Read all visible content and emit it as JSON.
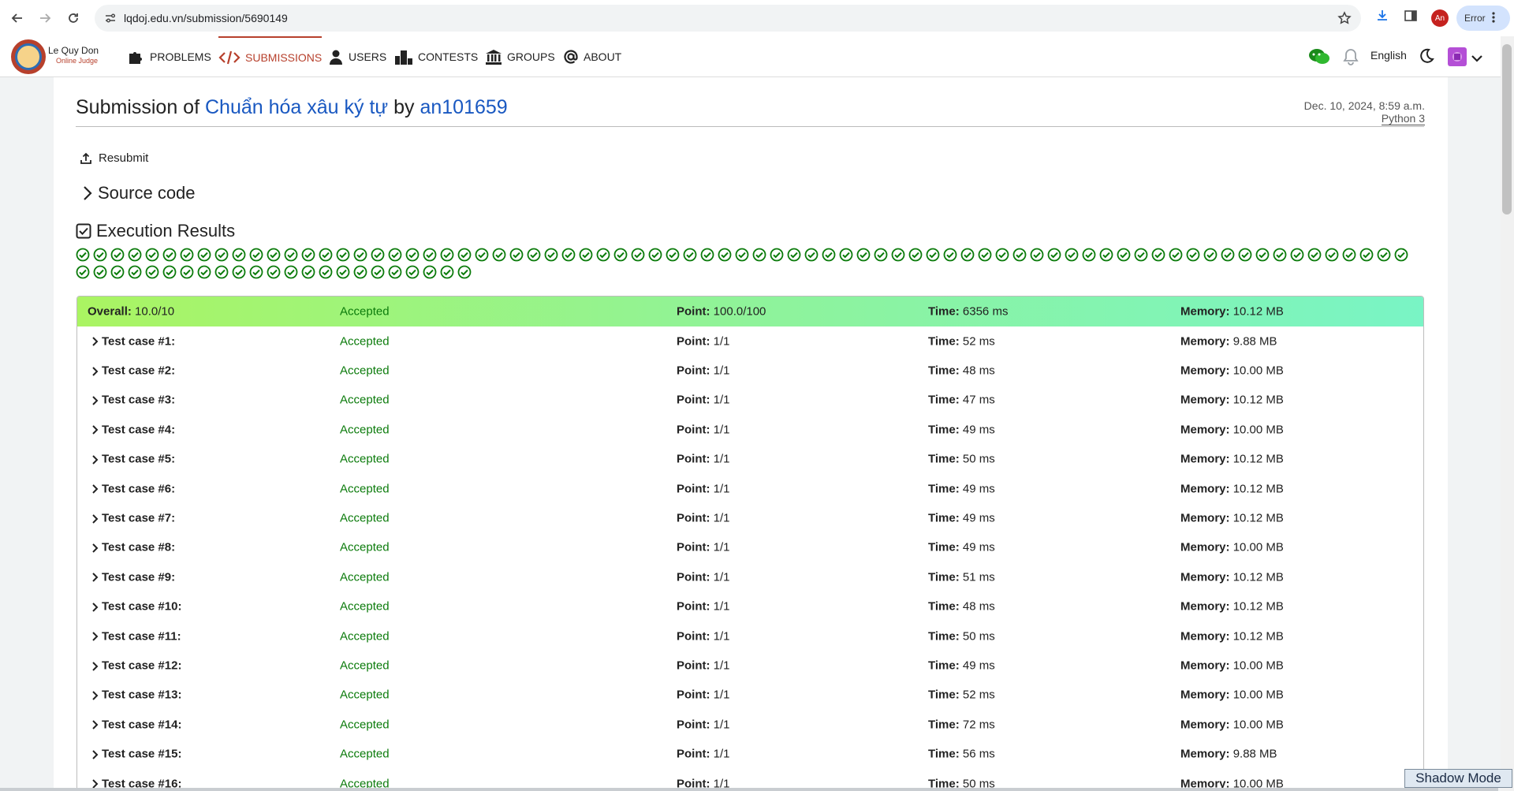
{
  "browser": {
    "url": "lqdoj.edu.vn/submission/5690149",
    "profile_initials": "An",
    "error_label": "Error"
  },
  "site": {
    "logo_line1": "Le Quy Don",
    "logo_line2": "Online Judge",
    "menu": [
      {
        "label": "PROBLEMS",
        "icon": "puzzle-icon"
      },
      {
        "label": "SUBMISSIONS",
        "icon": "code-icon",
        "active": true
      },
      {
        "label": "USERS",
        "icon": "user-icon"
      },
      {
        "label": "CONTESTS",
        "icon": "podium-icon"
      },
      {
        "label": "GROUPS",
        "icon": "institution-icon"
      },
      {
        "label": "ABOUT",
        "icon": "at-icon"
      }
    ],
    "language": "English"
  },
  "submission": {
    "title_prefix": "Submission of",
    "problem_name": "Chuẩn hóa xâu ký tự",
    "by_word": "by",
    "username": "an101659",
    "date": "Dec. 10, 2024, 8:59 a.m.",
    "language": "Python 3",
    "resubmit_label": "Resubmit",
    "source_code_label": "Source code",
    "execution_results_label": "Execution Results",
    "passed_case_count": 100
  },
  "results": {
    "labels": {
      "point": "Point:",
      "time": "Time:",
      "memory": "Memory:"
    },
    "overall": {
      "label": "Overall:",
      "score": "10.0/10",
      "status": "Accepted",
      "point": "100.0/100",
      "time": "6356 ms",
      "memory": "10.12 MB"
    },
    "cases": [
      {
        "label": "Test case #1:",
        "status": "Accepted",
        "point": "1/1",
        "time": "52 ms",
        "memory": "9.88 MB"
      },
      {
        "label": "Test case #2:",
        "status": "Accepted",
        "point": "1/1",
        "time": "48 ms",
        "memory": "10.00 MB"
      },
      {
        "label": "Test case #3:",
        "status": "Accepted",
        "point": "1/1",
        "time": "47 ms",
        "memory": "10.12 MB"
      },
      {
        "label": "Test case #4:",
        "status": "Accepted",
        "point": "1/1",
        "time": "49 ms",
        "memory": "10.00 MB"
      },
      {
        "label": "Test case #5:",
        "status": "Accepted",
        "point": "1/1",
        "time": "50 ms",
        "memory": "10.12 MB"
      },
      {
        "label": "Test case #6:",
        "status": "Accepted",
        "point": "1/1",
        "time": "49 ms",
        "memory": "10.12 MB"
      },
      {
        "label": "Test case #7:",
        "status": "Accepted",
        "point": "1/1",
        "time": "49 ms",
        "memory": "10.12 MB"
      },
      {
        "label": "Test case #8:",
        "status": "Accepted",
        "point": "1/1",
        "time": "49 ms",
        "memory": "10.00 MB"
      },
      {
        "label": "Test case #9:",
        "status": "Accepted",
        "point": "1/1",
        "time": "51 ms",
        "memory": "10.12 MB"
      },
      {
        "label": "Test case #10:",
        "status": "Accepted",
        "point": "1/1",
        "time": "48 ms",
        "memory": "10.12 MB"
      },
      {
        "label": "Test case #11:",
        "status": "Accepted",
        "point": "1/1",
        "time": "50 ms",
        "memory": "10.12 MB"
      },
      {
        "label": "Test case #12:",
        "status": "Accepted",
        "point": "1/1",
        "time": "49 ms",
        "memory": "10.00 MB"
      },
      {
        "label": "Test case #13:",
        "status": "Accepted",
        "point": "1/1",
        "time": "52 ms",
        "memory": "10.00 MB"
      },
      {
        "label": "Test case #14:",
        "status": "Accepted",
        "point": "1/1",
        "time": "72 ms",
        "memory": "10.00 MB"
      },
      {
        "label": "Test case #15:",
        "status": "Accepted",
        "point": "1/1",
        "time": "56 ms",
        "memory": "9.88 MB"
      },
      {
        "label": "Test case #16:",
        "status": "Accepted",
        "point": "1/1",
        "time": "50 ms",
        "memory": "10.00 MB"
      }
    ]
  },
  "overlay": {
    "shadow_mode_label": "Shadow Mode"
  },
  "colors": {
    "accent": "#b7402c",
    "link": "#1958c1",
    "accepted": "#0b7b0b"
  }
}
